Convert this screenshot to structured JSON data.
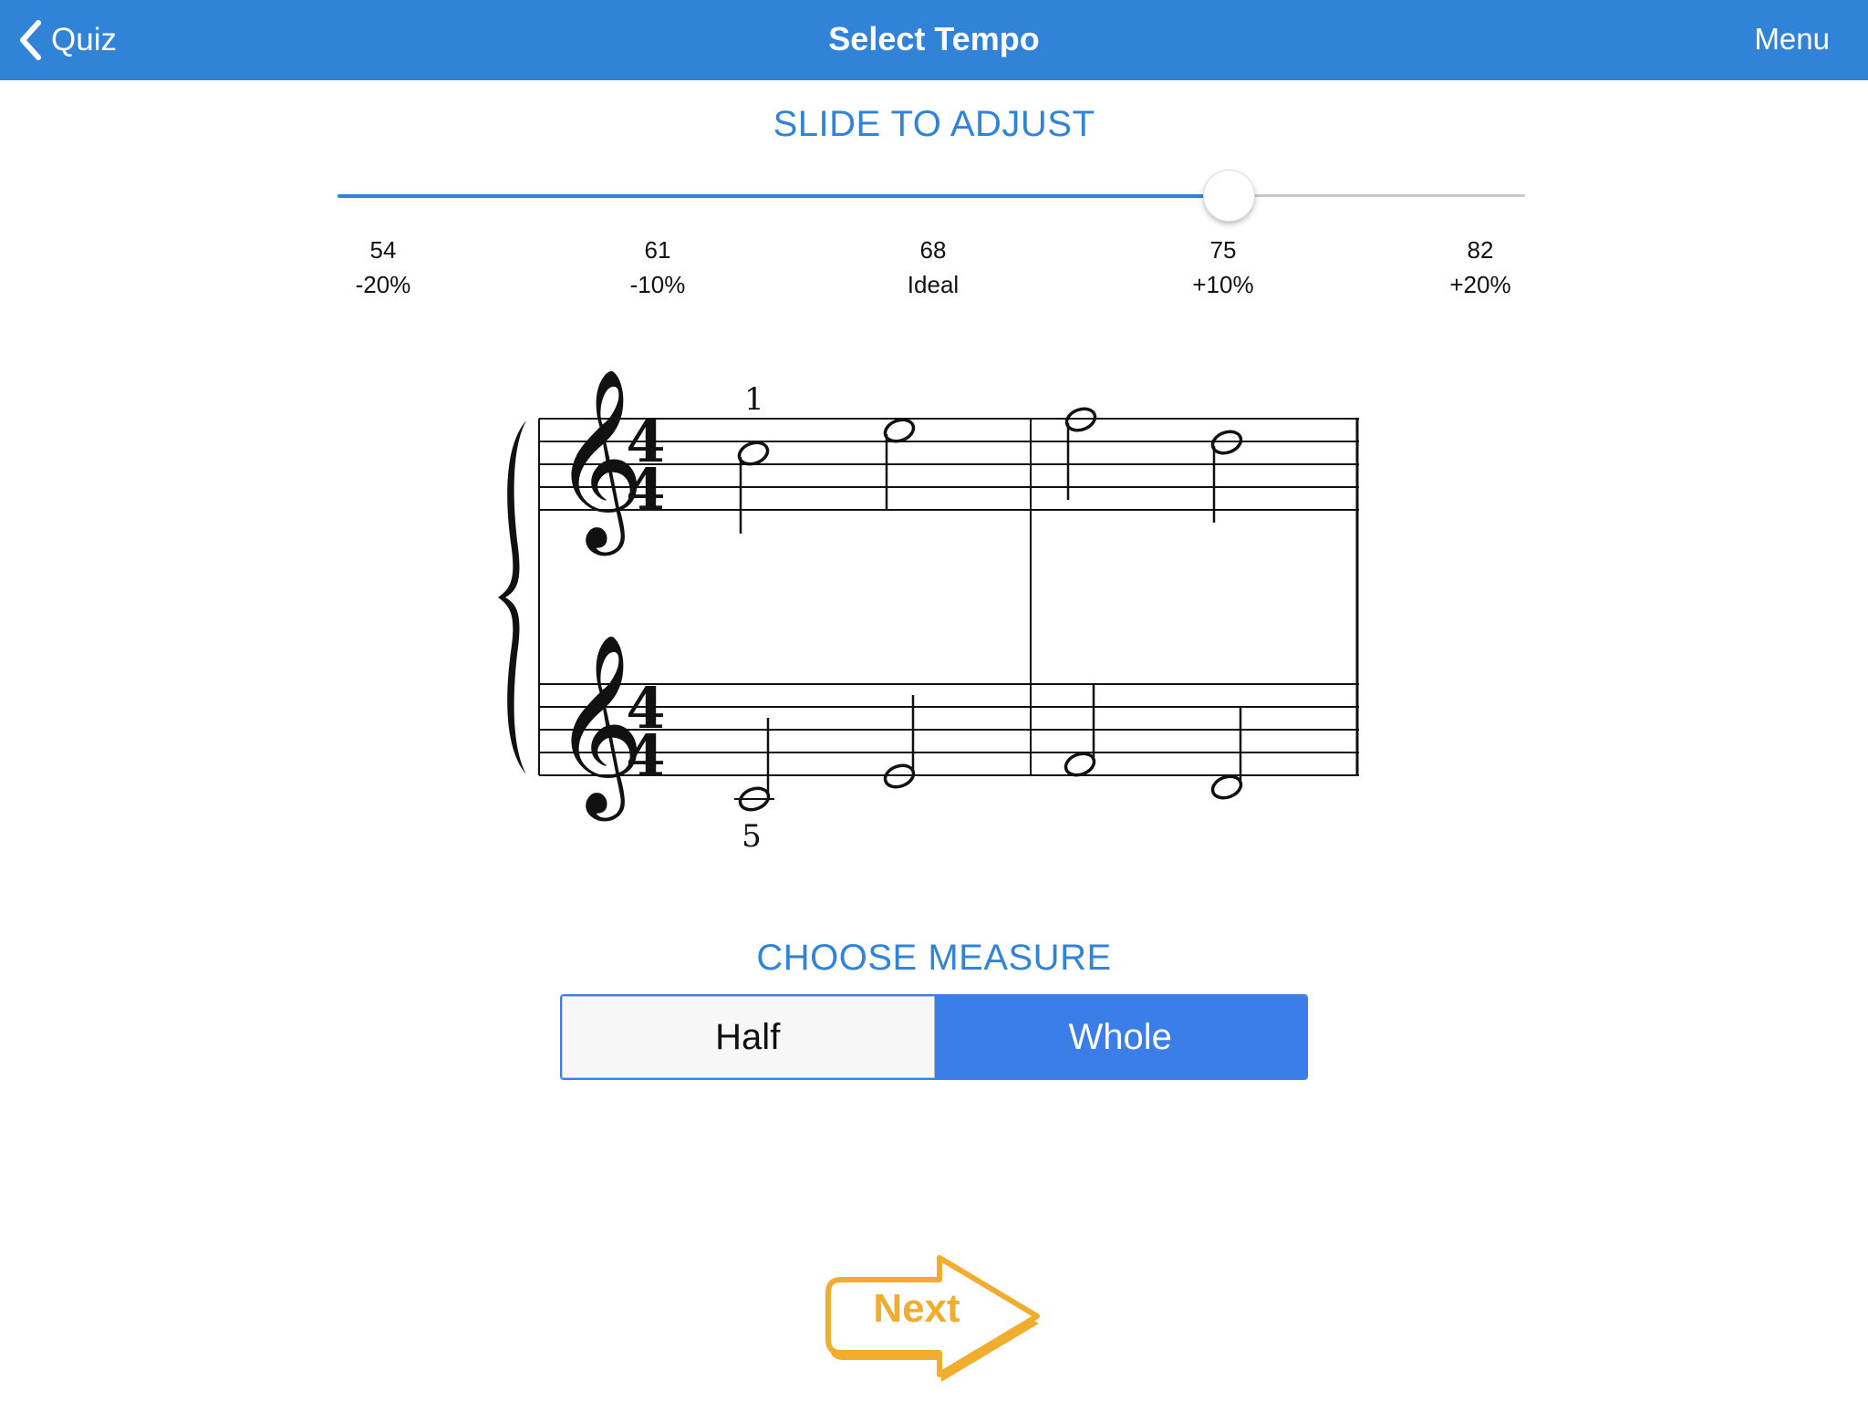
{
  "navbar": {
    "back_label": "Quiz",
    "title": "Select Tempo",
    "menu_label": "Menu"
  },
  "slider_section": {
    "heading": "SLIDE TO ADJUST",
    "value": 75,
    "min": 54,
    "max": 82,
    "ticks": [
      {
        "bpm": "54",
        "label": "-20%"
      },
      {
        "bpm": "61",
        "label": "-10%"
      },
      {
        "bpm": "68",
        "label": "Ideal"
      },
      {
        "bpm": "75",
        "label": "+10%"
      },
      {
        "bpm": "82",
        "label": "+20%"
      }
    ]
  },
  "score": {
    "time_signature_top": "4",
    "time_signature_bottom": "4",
    "finger_top": "1",
    "finger_bottom": "5"
  },
  "measure_section": {
    "heading": "CHOOSE MEASURE",
    "options": [
      "Half",
      "Whole"
    ],
    "selected": "Whole"
  },
  "next_button": {
    "label": "Next"
  },
  "colors": {
    "nav_blue": "#3183d7",
    "segment_blue": "#3b7ee8",
    "next_orange": "#f0ad2e"
  }
}
